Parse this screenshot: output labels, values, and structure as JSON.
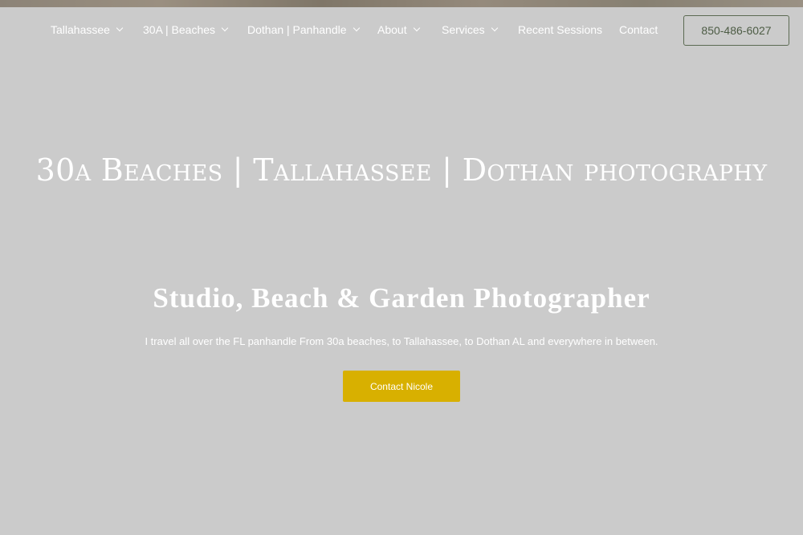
{
  "nav": {
    "items": [
      {
        "label": "Tallahassee",
        "has_dropdown": true
      },
      {
        "label": "30A | Beaches",
        "has_dropdown": true
      },
      {
        "label": "Dothan | Panhandle",
        "has_dropdown": true
      },
      {
        "label": "About",
        "has_dropdown": true
      },
      {
        "label": "Services",
        "has_dropdown": true
      },
      {
        "label": "Recent Sessions",
        "has_dropdown": false
      },
      {
        "label": "Contact",
        "has_dropdown": false
      }
    ],
    "phone": "850-486-6027",
    "dropdown_icon": "chevron-down-icon"
  },
  "hero": {
    "title": "30a Beaches | Tallahassee | Dothan photography",
    "subtitle": "Studio, Beach & Garden Photographer",
    "text": "I travel all over the FL panhandle From 30a beaches, to Tallahassee, to Dothan AL and everywhere in between.",
    "cta_label": "Contact Nicole"
  },
  "colors": {
    "background": "#cbcbcb",
    "text": "#ffffff",
    "cta": "#d8b000",
    "phone_border": "#5b6a52",
    "phone_text": "#4d5c45"
  }
}
